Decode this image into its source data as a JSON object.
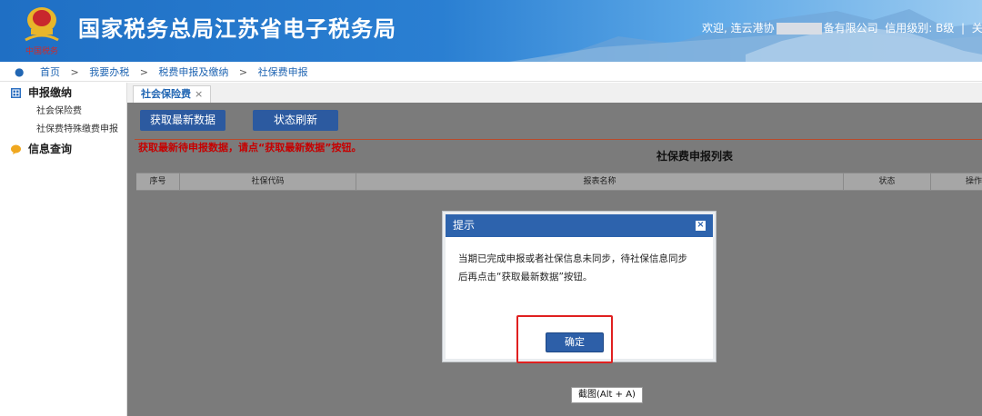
{
  "header": {
    "title": "国家税务总局江苏省电子税务局",
    "welcome_prefix": "欢迎, 连云港协",
    "welcome_suffix": "备有限公司",
    "credit_label": "信用级别: B级",
    "separator": "|",
    "trailing": "关"
  },
  "breadcrumb": {
    "items": [
      "首页",
      "我要办税",
      "税费申报及缴纳",
      "社保费申报"
    ],
    "separator": ">"
  },
  "sidebar": {
    "groups": [
      {
        "label": "申报缴纳",
        "items": [
          "社会保险费",
          "社保费特殊缴费申报"
        ]
      },
      {
        "label": "信息查询",
        "items": []
      }
    ]
  },
  "tabs": [
    {
      "label": "社会保险费",
      "close": "×"
    }
  ],
  "toolbar": {
    "fetch_label": "获取最新数据",
    "refresh_label": "状态刷新"
  },
  "warning_text": "获取最新待申报数据，请点“获取最新数据”按钮。",
  "list": {
    "title": "社保费申报列表",
    "columns": [
      "序号",
      "社保代码",
      "报表名称",
      "状态",
      "操作"
    ]
  },
  "modal": {
    "title": "提示",
    "close": "×",
    "message_line1": "当期已完成申报或者社保信息未同步，待社保信息同步",
    "message_line2": "后再点击“获取最新数据”按钮。",
    "ok_label": "确定"
  },
  "tooltip": "截图(Alt + A)",
  "colors": {
    "header_blue": "#1f6fc4",
    "button_blue": "#2c5aa0",
    "warning_red": "#c60000",
    "highlight_red": "#e02020"
  }
}
